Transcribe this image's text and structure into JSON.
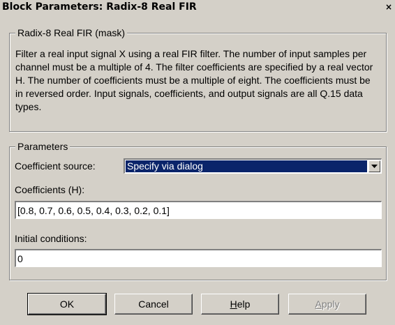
{
  "window": {
    "title": "Block Parameters: Radix-8 Real FIR",
    "close_glyph": "×"
  },
  "mask_group": {
    "legend": "Radix-8 Real FIR (mask)",
    "description": "Filter a real input signal X using a real FIR filter.  The number of input samples per channel must be a multiple of 4.  The filter coefficients are specified by a real vector H.  The number of coefficients must be a multiple of eight.  The coefficients must be in reversed order.  Input signals, coefficients, and output signals are all Q.15 data types."
  },
  "parameters": {
    "legend": "Parameters",
    "coefficient_source_label": "Coefficient source:",
    "coefficient_source_value": "Specify via dialog",
    "coefficients_label": "Coefficients (H):",
    "coefficients_value": "[0.8, 0.7, 0.6, 0.5, 0.4, 0.3, 0.2, 0.1]",
    "initial_conditions_label": "Initial conditions:",
    "initial_conditions_value": "0"
  },
  "buttons": {
    "ok": "OK",
    "cancel": "Cancel",
    "help_mnemonic": "H",
    "help_rest": "elp",
    "apply_mnemonic": "A",
    "apply_rest": "pply"
  },
  "colors": {
    "dialog_face": "#d4d0c8",
    "selection": "#0a246a",
    "disabled_text": "#808080"
  },
  "icons": {
    "dropdown": "chevron-down-icon",
    "close": "close-icon"
  }
}
